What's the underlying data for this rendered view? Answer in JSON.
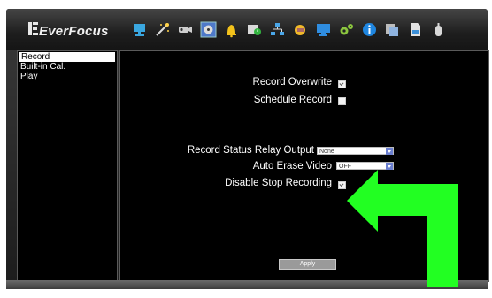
{
  "app": {
    "logo_text": "EverFocus",
    "toolbar_icons": [
      "network-icon",
      "magic-wand-icon",
      "camera-icon",
      "record-film-icon",
      "alarm-bell-icon",
      "schedule-icon",
      "network-tree-icon",
      "event-icon",
      "display-icon",
      "settings-gears-icon",
      "info-icon",
      "copy-icon",
      "document-icon",
      "power-icon"
    ]
  },
  "sidebar": {
    "items": [
      {
        "label": "Record",
        "selected": true
      },
      {
        "label": "Built-in Cal.",
        "selected": false
      },
      {
        "label": "Play",
        "selected": false
      }
    ]
  },
  "main": {
    "record_overwrite": {
      "label": "Record Overwrite",
      "checked": true
    },
    "schedule_record": {
      "label": "Schedule Record",
      "checked": false
    },
    "relay_output": {
      "label": "Record Status Relay Output",
      "value": "None"
    },
    "auto_erase": {
      "label": "Auto Erase Video",
      "value": "OFF"
    },
    "disable_stop": {
      "label": "Disable Stop Recording",
      "checked": true
    },
    "apply_label": "Apply"
  },
  "colors": {
    "annotation_arrow": "#22ff22",
    "dropdown_arrow": "#6b7fd0"
  }
}
